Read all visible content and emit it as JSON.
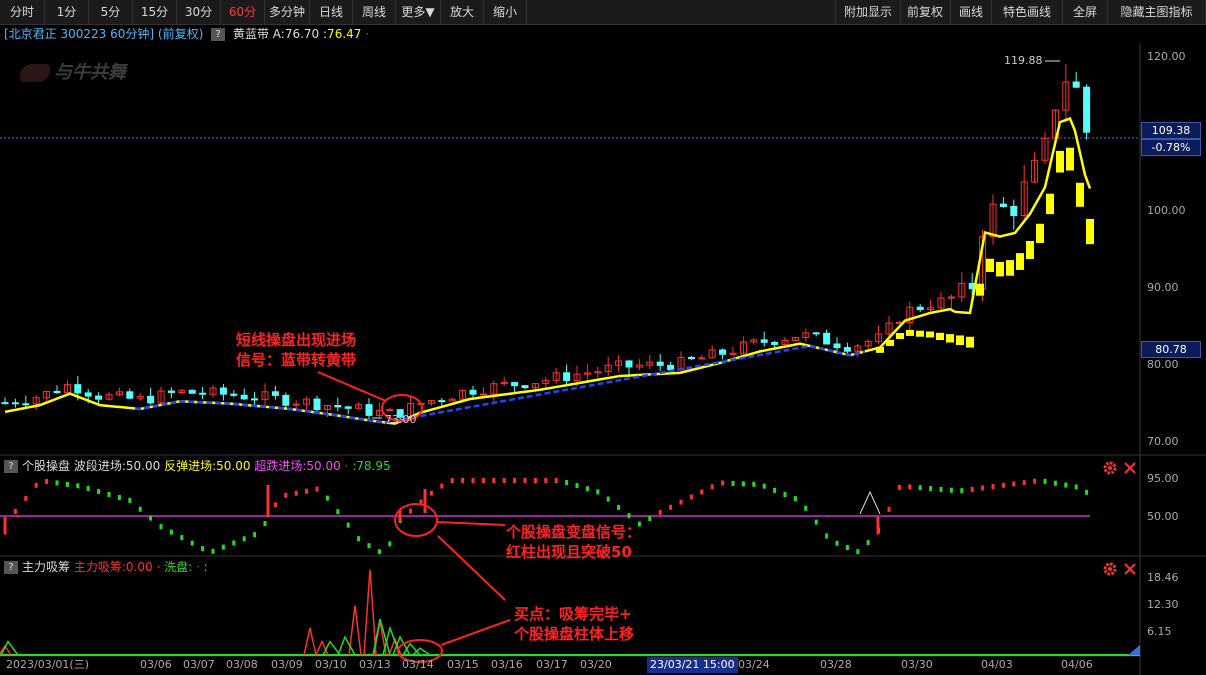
{
  "toolbar": {
    "left": [
      "分时",
      "1分",
      "5分",
      "15分",
      "30分",
      "60分",
      "多分钟",
      "日线",
      "周线",
      "更多▼",
      "放大",
      "缩小"
    ],
    "active": "60分",
    "right": [
      "附加显示",
      "前复权",
      "画线",
      "特色画线",
      "全屏",
      "隐藏主图指标"
    ]
  },
  "info": {
    "stock": "[北京君正 300223 60分钟]",
    "adj": "(前复权)",
    "help": "?",
    "indicator": "黄蓝带",
    "a_value": "A:76.70",
    "b_value": ":76.47",
    "dot": "·"
  },
  "watermark": "与牛共舞",
  "main_axis": [
    "120.00",
    "100.00",
    "90.00",
    "80.00",
    "70.00"
  ],
  "current_price": "109.38",
  "current_change": "-0.78%",
  "band_level": "80.78",
  "high_label": "119.88",
  "low_label": "73.00",
  "panel2": {
    "help": "?",
    "name": "个股操盘",
    "l1": "波段进场:50.00",
    "l2": "反弹进场:50.00",
    "l3": "超跌进场:50.00",
    "l4": "·",
    "l5": ":78.95",
    "axis": [
      "95.00",
      "50.00"
    ]
  },
  "panel3": {
    "help": "?",
    "name": "主力吸筹",
    "l1": "主力吸筹:0.00",
    "l2": "·",
    "l3": "洗盘:",
    "l4": "·",
    "l5": ":",
    "axis": [
      "18.46",
      "12.30",
      "6.15"
    ]
  },
  "dates": [
    "2023/03/01(三)",
    "03/06",
    "03/07",
    "03/08",
    "03/09",
    "03/10",
    "03/13",
    "03/14",
    "03/15",
    "03/16",
    "03/17",
    "03/20",
    "23/03/21 15:00",
    "03/24",
    "03/28",
    "03/30",
    "04/03",
    "04/06"
  ],
  "annotations": {
    "a1_line1": "短线操盘出现进场",
    "a1_line2": "信号：蓝带转黄带",
    "a2_line1": "个股操盘变盘信号：",
    "a2_line2": "红柱出现且突破50",
    "a3_line1": "买点：吸筹完毕+",
    "a3_line2": "个股操盘柱体上移"
  },
  "icons": [
    "help-icon",
    "settings-gear-icon",
    "close-x-icon",
    "collapse-triangle-icon"
  ],
  "colors": {
    "up": "#ff3030",
    "down": "#54ffff",
    "band_yellow": "#ffff00",
    "band_blue": "#2244ff",
    "ma50": "#cc33cc",
    "green": "#22dd22",
    "accent_red": "#ff2222"
  }
}
